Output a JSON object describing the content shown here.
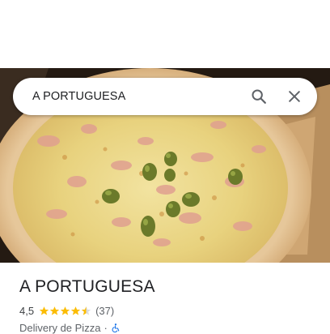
{
  "search": {
    "query": "A PORTUGUESA"
  },
  "icons": {
    "search": "search-icon",
    "close": "close-icon",
    "accessibility": "wheelchair-icon"
  },
  "place": {
    "name": "A PORTUGUESA",
    "rating": "4,5",
    "rating_stars": 4.5,
    "review_count": "(37)",
    "category": "Delivery de Pizza",
    "separator": "·"
  },
  "colors": {
    "star": "#fbbc04",
    "text_primary": "#202124",
    "text_secondary": "#5f6368",
    "icon": "#5f6368",
    "accessibility": "#1a73e8"
  }
}
